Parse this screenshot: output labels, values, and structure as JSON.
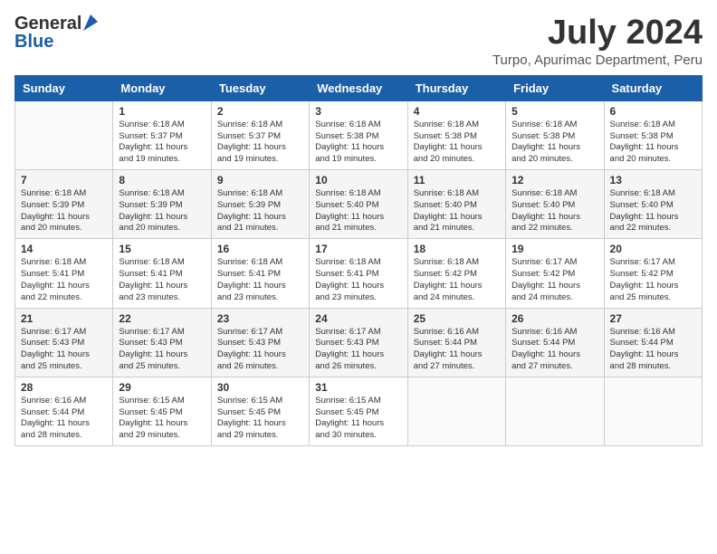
{
  "header": {
    "logo_general": "General",
    "logo_blue": "Blue",
    "month": "July 2024",
    "location": "Turpo, Apurimac Department, Peru"
  },
  "calendar": {
    "days_of_week": [
      "Sunday",
      "Monday",
      "Tuesday",
      "Wednesday",
      "Thursday",
      "Friday",
      "Saturday"
    ],
    "weeks": [
      [
        {
          "day": "",
          "info": ""
        },
        {
          "day": "1",
          "info": "Sunrise: 6:18 AM\nSunset: 5:37 PM\nDaylight: 11 hours\nand 19 minutes."
        },
        {
          "day": "2",
          "info": "Sunrise: 6:18 AM\nSunset: 5:37 PM\nDaylight: 11 hours\nand 19 minutes."
        },
        {
          "day": "3",
          "info": "Sunrise: 6:18 AM\nSunset: 5:38 PM\nDaylight: 11 hours\nand 19 minutes."
        },
        {
          "day": "4",
          "info": "Sunrise: 6:18 AM\nSunset: 5:38 PM\nDaylight: 11 hours\nand 20 minutes."
        },
        {
          "day": "5",
          "info": "Sunrise: 6:18 AM\nSunset: 5:38 PM\nDaylight: 11 hours\nand 20 minutes."
        },
        {
          "day": "6",
          "info": "Sunrise: 6:18 AM\nSunset: 5:38 PM\nDaylight: 11 hours\nand 20 minutes."
        }
      ],
      [
        {
          "day": "7",
          "info": "Sunrise: 6:18 AM\nSunset: 5:39 PM\nDaylight: 11 hours\nand 20 minutes."
        },
        {
          "day": "8",
          "info": "Sunrise: 6:18 AM\nSunset: 5:39 PM\nDaylight: 11 hours\nand 20 minutes."
        },
        {
          "day": "9",
          "info": "Sunrise: 6:18 AM\nSunset: 5:39 PM\nDaylight: 11 hours\nand 21 minutes."
        },
        {
          "day": "10",
          "info": "Sunrise: 6:18 AM\nSunset: 5:40 PM\nDaylight: 11 hours\nand 21 minutes."
        },
        {
          "day": "11",
          "info": "Sunrise: 6:18 AM\nSunset: 5:40 PM\nDaylight: 11 hours\nand 21 minutes."
        },
        {
          "day": "12",
          "info": "Sunrise: 6:18 AM\nSunset: 5:40 PM\nDaylight: 11 hours\nand 22 minutes."
        },
        {
          "day": "13",
          "info": "Sunrise: 6:18 AM\nSunset: 5:40 PM\nDaylight: 11 hours\nand 22 minutes."
        }
      ],
      [
        {
          "day": "14",
          "info": "Sunrise: 6:18 AM\nSunset: 5:41 PM\nDaylight: 11 hours\nand 22 minutes."
        },
        {
          "day": "15",
          "info": "Sunrise: 6:18 AM\nSunset: 5:41 PM\nDaylight: 11 hours\nand 23 minutes."
        },
        {
          "day": "16",
          "info": "Sunrise: 6:18 AM\nSunset: 5:41 PM\nDaylight: 11 hours\nand 23 minutes."
        },
        {
          "day": "17",
          "info": "Sunrise: 6:18 AM\nSunset: 5:41 PM\nDaylight: 11 hours\nand 23 minutes."
        },
        {
          "day": "18",
          "info": "Sunrise: 6:18 AM\nSunset: 5:42 PM\nDaylight: 11 hours\nand 24 minutes."
        },
        {
          "day": "19",
          "info": "Sunrise: 6:17 AM\nSunset: 5:42 PM\nDaylight: 11 hours\nand 24 minutes."
        },
        {
          "day": "20",
          "info": "Sunrise: 6:17 AM\nSunset: 5:42 PM\nDaylight: 11 hours\nand 25 minutes."
        }
      ],
      [
        {
          "day": "21",
          "info": "Sunrise: 6:17 AM\nSunset: 5:43 PM\nDaylight: 11 hours\nand 25 minutes."
        },
        {
          "day": "22",
          "info": "Sunrise: 6:17 AM\nSunset: 5:43 PM\nDaylight: 11 hours\nand 25 minutes."
        },
        {
          "day": "23",
          "info": "Sunrise: 6:17 AM\nSunset: 5:43 PM\nDaylight: 11 hours\nand 26 minutes."
        },
        {
          "day": "24",
          "info": "Sunrise: 6:17 AM\nSunset: 5:43 PM\nDaylight: 11 hours\nand 26 minutes."
        },
        {
          "day": "25",
          "info": "Sunrise: 6:16 AM\nSunset: 5:44 PM\nDaylight: 11 hours\nand 27 minutes."
        },
        {
          "day": "26",
          "info": "Sunrise: 6:16 AM\nSunset: 5:44 PM\nDaylight: 11 hours\nand 27 minutes."
        },
        {
          "day": "27",
          "info": "Sunrise: 6:16 AM\nSunset: 5:44 PM\nDaylight: 11 hours\nand 28 minutes."
        }
      ],
      [
        {
          "day": "28",
          "info": "Sunrise: 6:16 AM\nSunset: 5:44 PM\nDaylight: 11 hours\nand 28 minutes."
        },
        {
          "day": "29",
          "info": "Sunrise: 6:15 AM\nSunset: 5:45 PM\nDaylight: 11 hours\nand 29 minutes."
        },
        {
          "day": "30",
          "info": "Sunrise: 6:15 AM\nSunset: 5:45 PM\nDaylight: 11 hours\nand 29 minutes."
        },
        {
          "day": "31",
          "info": "Sunrise: 6:15 AM\nSunset: 5:45 PM\nDaylight: 11 hours\nand 30 minutes."
        },
        {
          "day": "",
          "info": ""
        },
        {
          "day": "",
          "info": ""
        },
        {
          "day": "",
          "info": ""
        }
      ]
    ]
  }
}
